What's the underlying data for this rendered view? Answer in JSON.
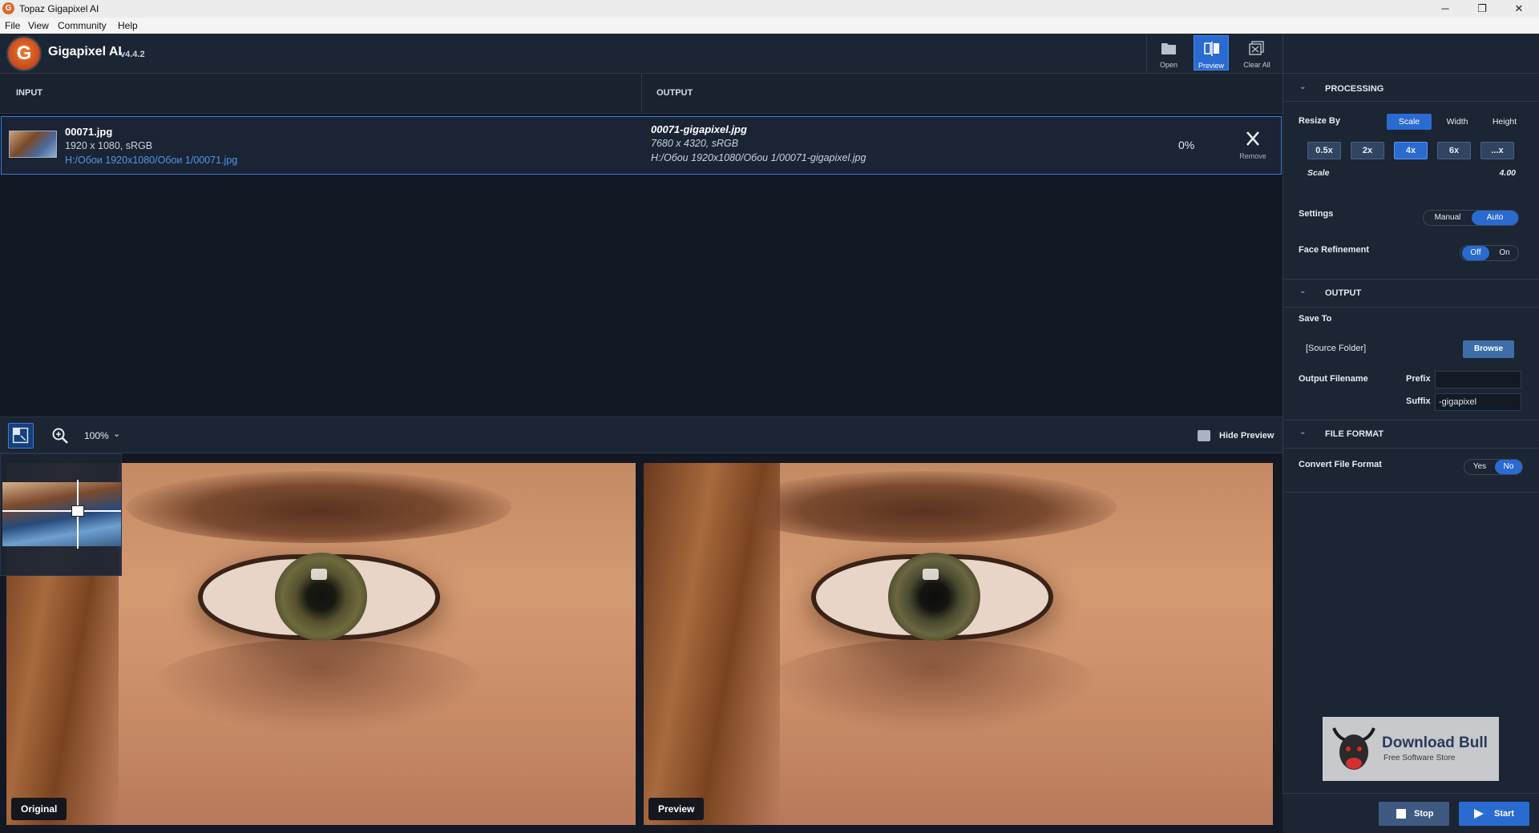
{
  "window": {
    "title": "Topaz Gigapixel AI",
    "minimize": "─",
    "maximize": "❐",
    "close": "✕",
    "app_icon": "G"
  },
  "menu": [
    "File",
    "View",
    "Community",
    "Help"
  ],
  "header": {
    "logo_letter": "G",
    "app_name": "Gigapixel AI",
    "version": "v4.4.2",
    "tools": {
      "open": "Open",
      "preview": "Preview",
      "clear_all": "Clear All"
    }
  },
  "columns": {
    "input": "INPUT",
    "output": "OUTPUT"
  },
  "file": {
    "input_name": "00071.jpg",
    "input_meta": "1920 x 1080, sRGB",
    "input_path": "H:/Обои 1920x1080/Обои 1/00071.jpg",
    "output_name": "00071-gigapixel.jpg",
    "output_meta": "7680 x 4320, sRGB",
    "output_path": "H:/Обои 1920x1080/Обои 1/00071-gigapixel.jpg",
    "progress": "0%",
    "remove_label": "Remove"
  },
  "preview_bar": {
    "zoom": "100%",
    "hide_preview": "Hide Preview"
  },
  "captions": {
    "original": "Original",
    "preview": "Preview"
  },
  "panel": {
    "processing": {
      "title": "PROCESSING",
      "resize_by_label": "Resize By",
      "resize_options": [
        "Scale",
        "Width",
        "Height"
      ],
      "resize_selected": "Scale",
      "scale_presets": [
        "0.5x",
        "2x",
        "4x",
        "6x",
        "...x"
      ],
      "scale_selected": "4x",
      "scale_label": "Scale",
      "scale_value": "4.00",
      "settings_label": "Settings",
      "settings_options": [
        "Manual",
        "Auto"
      ],
      "settings_selected": "Auto",
      "face_label": "Face Refinement",
      "face_options": [
        "Off",
        "On"
      ],
      "face_selected": "Off"
    },
    "output": {
      "title": "OUTPUT",
      "save_to_label": "Save To",
      "save_to_value": "[Source Folder]",
      "browse": "Browse",
      "filename_label": "Output Filename",
      "prefix_label": "Prefix",
      "prefix_value": "",
      "suffix_label": "Suffix",
      "suffix_value": "-gigapixel"
    },
    "file_format": {
      "title": "FILE FORMAT",
      "convert_label": "Convert File Format",
      "options": [
        "Yes",
        "No"
      ],
      "selected": "No"
    }
  },
  "watermark": {
    "title": "Download Bull",
    "subtitle": "Free Software Store"
  },
  "actions": {
    "stop": "Stop",
    "start": "Start"
  },
  "colors": {
    "accent": "#2a6bd1",
    "background": "#121824",
    "panel": "#1c2533",
    "link": "#4f95e8"
  }
}
